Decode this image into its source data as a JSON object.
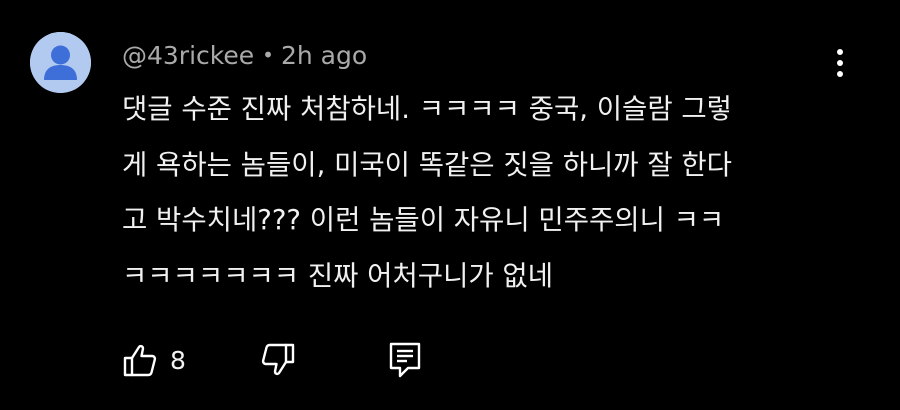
{
  "comment": {
    "avatar_icon": "default-user-avatar",
    "avatar_color": "#b2caf0",
    "author": "@43rickee",
    "separator": "•",
    "timestamp": "2h ago",
    "text": "댓글 수준 진짜 처참하네. ㅋㅋㅋㅋ 중국, 이슬람 그렇\n게 욕하는 놈들이, 미국이 똑같은 짓을 하니까 잘 한다\n고 박수치네??? 이런 놈들이 자유니 민주주의니 ㅋㅋ\nㅋㅋㅋㅋㅋㅋㅋ 진짜 어처구니가 없네",
    "like_count": "8",
    "icons": {
      "like": "thumbs-up-icon",
      "dislike": "thumbs-down-icon",
      "reply": "reply-icon",
      "more": "more-vertical-icon"
    }
  }
}
